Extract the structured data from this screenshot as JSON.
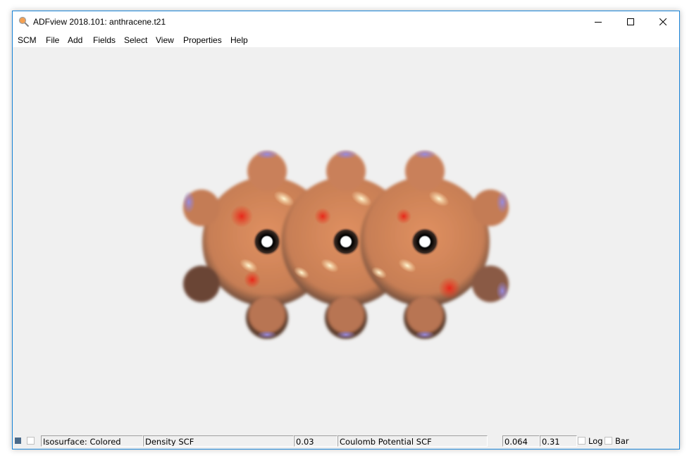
{
  "window": {
    "title": "ADFview 2018.101: anthracene.t21",
    "app_icon": "magnifier-icon",
    "controls": [
      "minimize-icon",
      "maximize-icon",
      "close-icon"
    ]
  },
  "menu": {
    "items": [
      {
        "label": "SCM"
      },
      {
        "label": "File"
      },
      {
        "label": "Add"
      },
      {
        "label": "Fields"
      },
      {
        "label": "Select"
      },
      {
        "label": "View"
      },
      {
        "label": "Properties"
      },
      {
        "label": "Help"
      }
    ]
  },
  "viewport": {
    "molecule": "anthracene",
    "surface_colors": {
      "base": "#d9895a",
      "negative": "#e8281a",
      "positive": "#8a7ec8",
      "highlight": "#fff2c8"
    }
  },
  "statusbar": {
    "color_swatch": "#4a6a8a",
    "visible_checked": false,
    "surface_type": "Isosurface: Colored",
    "field": "Density SCF",
    "iso_value": "0.03",
    "color_field": "Coulomb Potential SCF",
    "range_min": "0.064",
    "range_max": "0.31",
    "log_label": "Log",
    "log_checked": false,
    "bar_label": "Bar",
    "bar_checked": false
  }
}
